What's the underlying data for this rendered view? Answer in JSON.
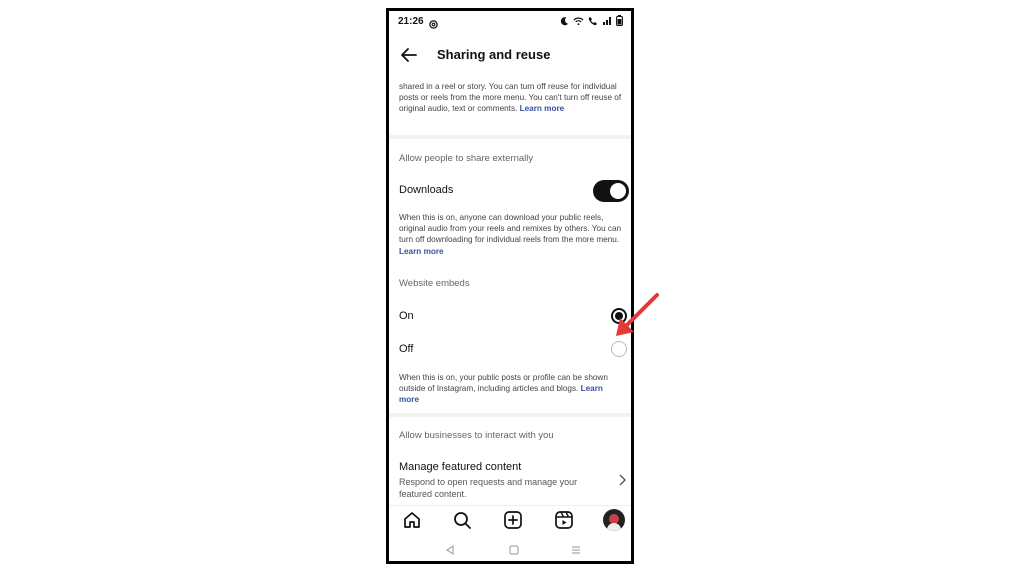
{
  "status": {
    "time": "21:26"
  },
  "header": {
    "title": "Sharing and reuse"
  },
  "intro": {
    "text": "shared in a reel or story. You can turn off reuse for individual posts or reels from the more menu. You can't turn off reuse of original audio, text or comments.",
    "link": "Learn more"
  },
  "share_externally": {
    "label": "Allow people to share externally",
    "downloads": {
      "label": "Downloads",
      "on": true,
      "description": "When this is on, anyone can download your public reels, original audio from your reels and remixes by others. You can turn off downloading for individual reels from the more menu.",
      "link": "Learn more"
    }
  },
  "website_embeds": {
    "label": "Website embeds",
    "options": [
      {
        "label": "On",
        "selected": true
      },
      {
        "label": "Off",
        "selected": false
      }
    ],
    "description": "When this is on, your public posts or profile can be shown outside of Instagram, including articles and blogs.",
    "link": "Learn more"
  },
  "businesses": {
    "label": "Allow businesses to interact with you",
    "featured": {
      "title": "Manage featured content",
      "subtitle": "Respond to open requests and manage your featured content."
    }
  },
  "nav": [
    "home-icon",
    "search-icon",
    "create-icon",
    "reels-icon",
    "profile-avatar"
  ],
  "annotation": {
    "arrow_color": "#e53935"
  }
}
